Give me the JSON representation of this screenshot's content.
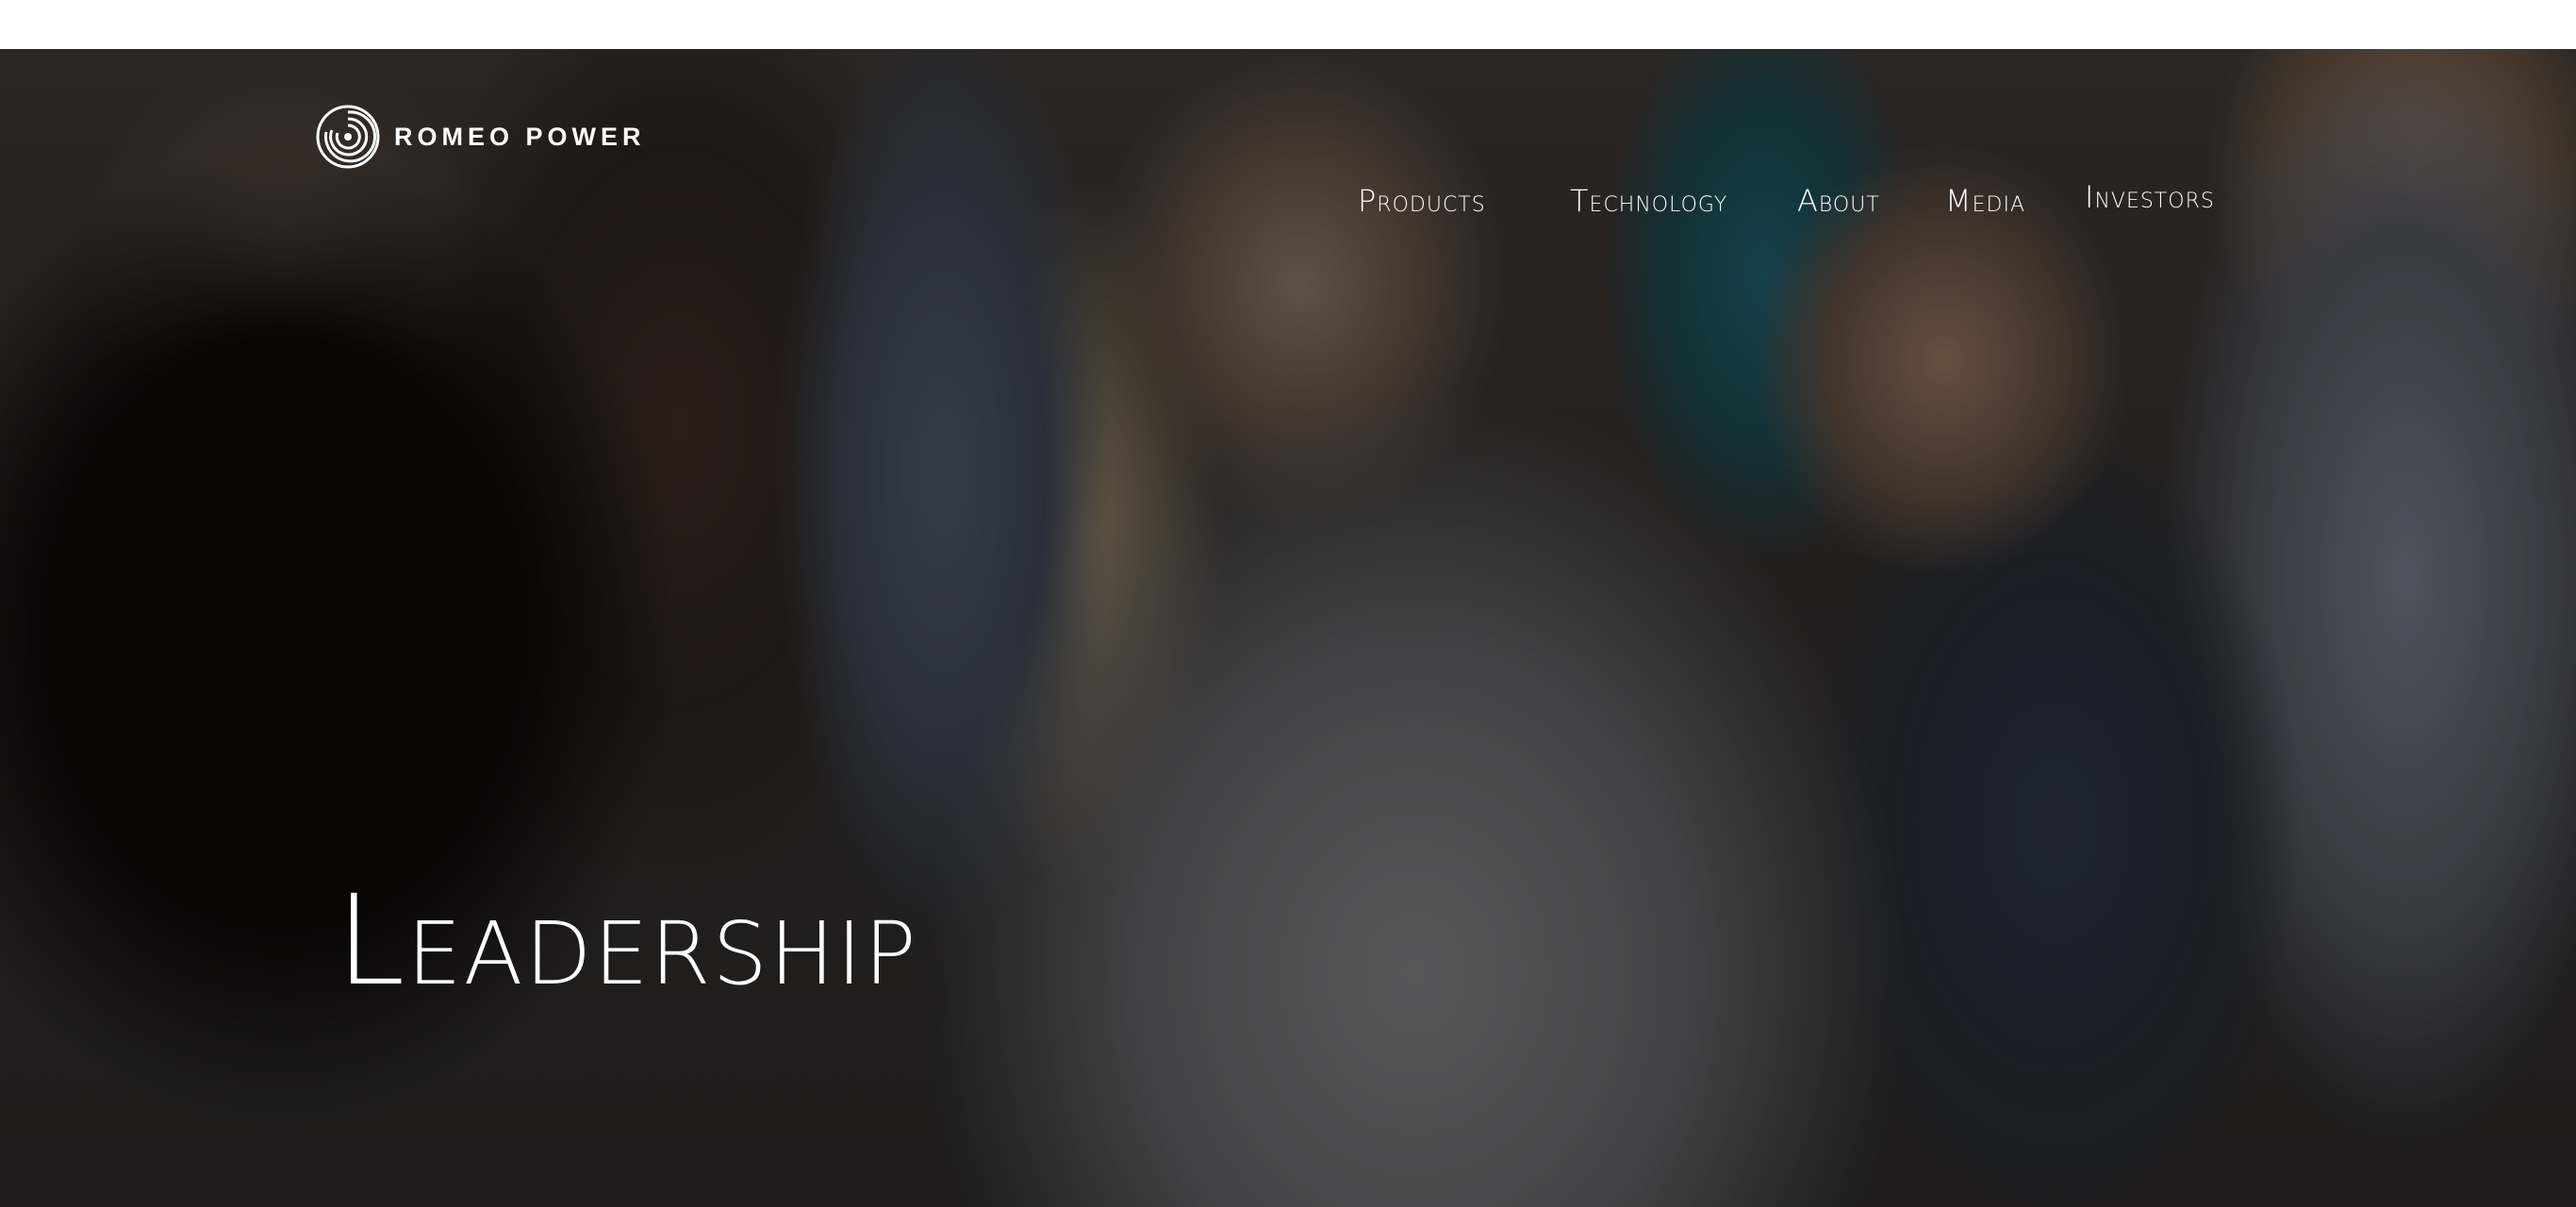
{
  "brand": {
    "name": "ROMEO POWER",
    "logo_icon": "concentric-rings-logo"
  },
  "nav": {
    "items": [
      {
        "label": "Products"
      },
      {
        "label": "Technology"
      },
      {
        "label": "About"
      },
      {
        "label": "Media"
      },
      {
        "label": "Investors"
      }
    ]
  },
  "hero": {
    "title": "Leadership",
    "background": "team-photo"
  },
  "colors": {
    "nav_text": "#ffffff",
    "title_text": "#ffffff",
    "top_strip": "#ffffff"
  }
}
